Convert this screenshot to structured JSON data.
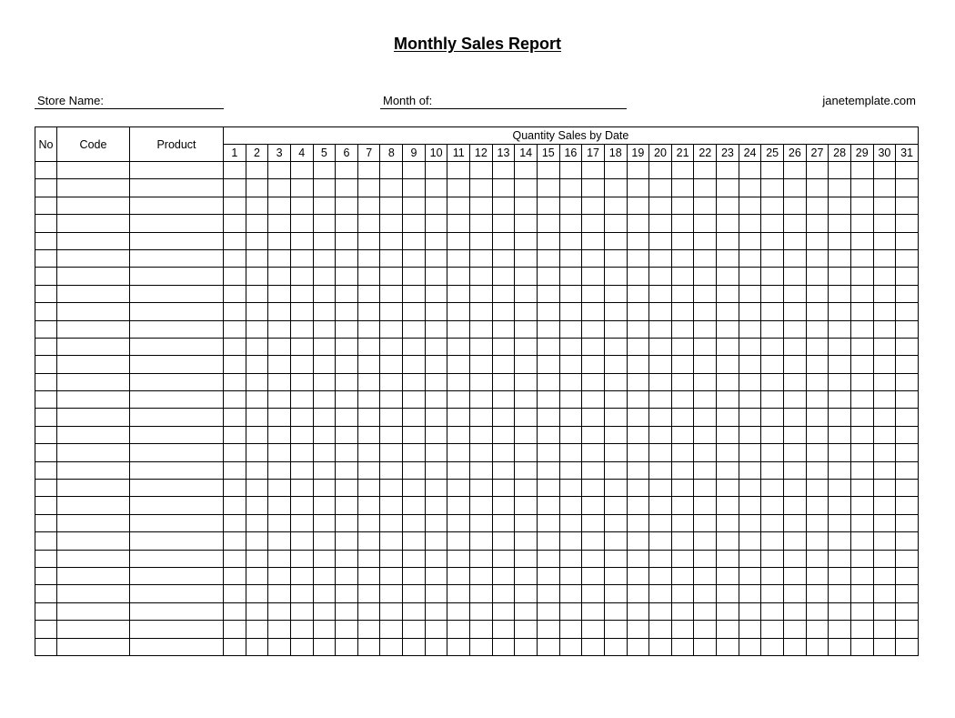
{
  "document": {
    "title": "Monthly Sales Report",
    "store_name_label": "Store Name:",
    "month_label": "Month of:",
    "website": "janetemplate.com"
  },
  "table": {
    "headers": {
      "no": "No",
      "code": "Code",
      "product": "Product",
      "group": "Quantity Sales by Date"
    },
    "days": [
      "1",
      "2",
      "3",
      "4",
      "5",
      "6",
      "7",
      "8",
      "9",
      "10",
      "11",
      "12",
      "13",
      "14",
      "15",
      "16",
      "17",
      "18",
      "19",
      "20",
      "21",
      "22",
      "23",
      "24",
      "25",
      "26",
      "27",
      "28",
      "29",
      "30",
      "31"
    ],
    "row_count": 28,
    "rows_note": "all cells empty"
  }
}
